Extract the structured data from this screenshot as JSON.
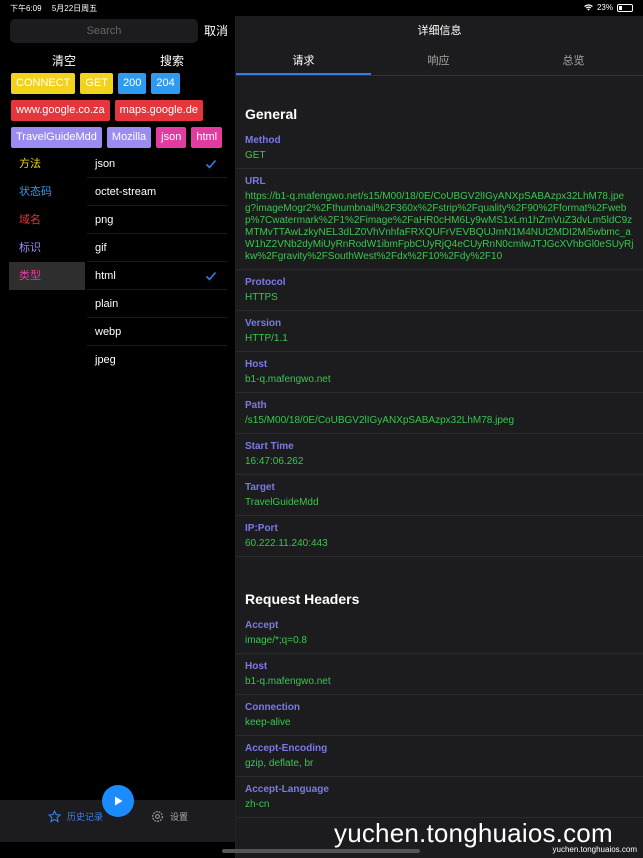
{
  "status_bar": {
    "time": "下午6:09",
    "date": "5月22日周五",
    "battery": "23%",
    "battery_level": 0.23
  },
  "search": {
    "placeholder": "Search",
    "cancel": "取消"
  },
  "filter_actions": {
    "clear": "清空",
    "search": "搜索"
  },
  "tags": [
    [
      {
        "label": "CONNECT",
        "bg": "#f2d21b",
        "fg": "#ffffff"
      },
      {
        "label": "GET",
        "bg": "#f2d21b",
        "fg": "#ffffff"
      },
      {
        "label": "200",
        "bg": "#2f9bf0",
        "fg": "#ffffff"
      },
      {
        "label": "204",
        "bg": "#2f9bf0",
        "fg": "#ffffff"
      }
    ],
    [
      {
        "label": "www.google.co.za",
        "bg": "#e5363d",
        "fg": "#ffffff"
      },
      {
        "label": "maps.google.de",
        "bg": "#e5363d",
        "fg": "#ffffff"
      }
    ],
    [
      {
        "label": "TravelGuideMdd",
        "bg": "#9b8cf2",
        "fg": "#ffffff"
      },
      {
        "label": "Mozilla",
        "bg": "#9b8cf2",
        "fg": "#ffffff"
      },
      {
        "label": "json",
        "bg": "#e43ba0",
        "fg": "#ffffff"
      },
      {
        "label": "html",
        "bg": "#e43ba0",
        "fg": "#ffffff"
      }
    ]
  ],
  "categories": [
    {
      "label": "方法",
      "color": "#f2d21b",
      "selected": false
    },
    {
      "label": "状态码",
      "color": "#2f9bf0",
      "selected": false
    },
    {
      "label": "域名",
      "color": "#e5363d",
      "selected": false
    },
    {
      "label": "标识",
      "color": "#9b8cf2",
      "selected": false
    },
    {
      "label": "类型",
      "color": "#e43ba0",
      "selected": true
    }
  ],
  "types": [
    {
      "label": "json",
      "checked": true
    },
    {
      "label": "octet-stream",
      "checked": false
    },
    {
      "label": "png",
      "checked": false
    },
    {
      "label": "gif",
      "checked": false
    },
    {
      "label": "html",
      "checked": true
    },
    {
      "label": "plain",
      "checked": false
    },
    {
      "label": "webp",
      "checked": false
    },
    {
      "label": "jpeg",
      "checked": false
    }
  ],
  "tab_bar": {
    "history": "历史记录",
    "settings": "设置"
  },
  "detail": {
    "title": "详细信息",
    "tabs": [
      "请求",
      "响应",
      "总览"
    ],
    "general_title": "General",
    "general": [
      {
        "label": "Method",
        "value": "GET"
      },
      {
        "label": "URL",
        "value": "https://b1-q.mafengwo.net/s15/M00/18/0E/CoUBGV2lIGyANXpSABAzpx32LhM78.jpeg?imageMogr2%2Fthumbnail%2F360x%2Fstrip%2Fquality%2F90%2Fformat%2Fwebp%7Cwatermark%2F1%2Fimage%2FaHR0cHM6Ly9wMS1xLm1hZmVuZ3dvLm5ldC9zMTMvTTAwLzkyNEL3dLZ0VhVnhfaFRXQUFrVEVBQUJmN1M4NUt2MDI2Mi5wbmc_aW1hZ2VNb2dyMiUyRnRodW1ibmFpbCUyRjQ4eCUyRnN0cmlwJTJGcXVhbGl0eSUyRjkw%2Fgravity%2FSouthWest%2Fdx%2F10%2Fdy%2F10"
      },
      {
        "label": "Protocol",
        "value": "HTTPS"
      },
      {
        "label": "Version",
        "value": "HTTP/1.1"
      },
      {
        "label": "Host",
        "value": "b1-q.mafengwo.net"
      },
      {
        "label": "Path",
        "value": "/s15/M00/18/0E/CoUBGV2lIGyANXpSABAzpx32LhM78.jpeg"
      },
      {
        "label": "Start Time",
        "value": "16:47:06.262"
      },
      {
        "label": "Target",
        "value": "TravelGuideMdd"
      },
      {
        "label": "IP:Port",
        "value": "60.222.11.240:443"
      }
    ],
    "headers_title": "Request Headers",
    "headers": [
      {
        "label": "Accept",
        "value": "image/*;q=0.8"
      },
      {
        "label": "Host",
        "value": "b1-q.mafengwo.net"
      },
      {
        "label": "Connection",
        "value": "keep-alive"
      },
      {
        "label": "Accept-Encoding",
        "value": "gzip, deflate, br"
      },
      {
        "label": "Accept-Language",
        "value": "zh-cn"
      }
    ]
  },
  "watermark": {
    "large": "yuchen.tonghuaios.com",
    "small": "yuchen.tonghuaios.com"
  }
}
